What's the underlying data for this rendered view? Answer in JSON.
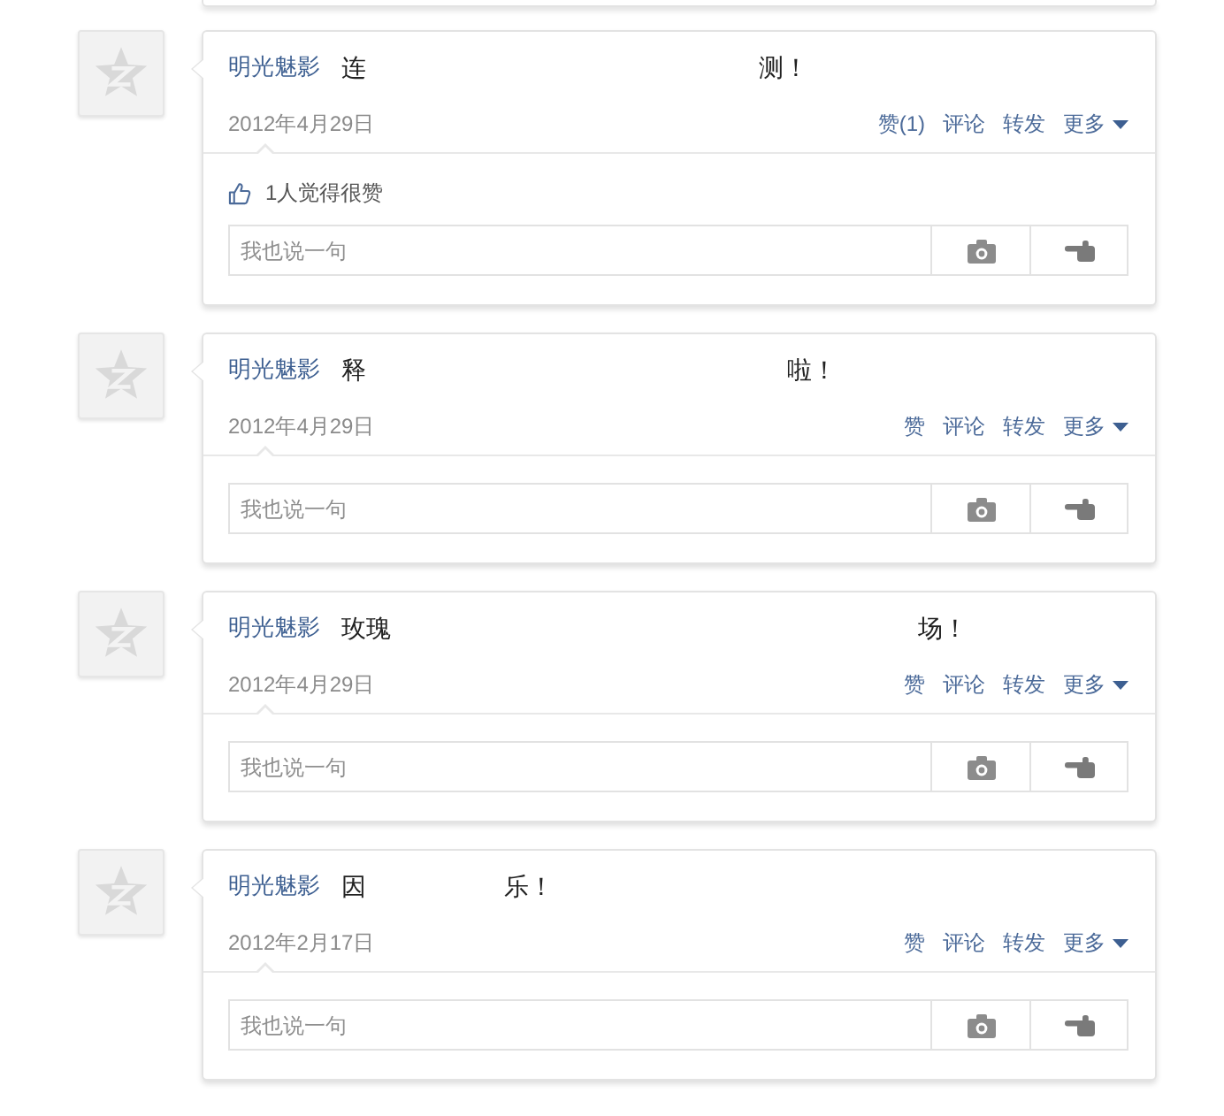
{
  "posts": [
    {
      "author": "明光魅影",
      "text_fragments": [
        "连",
        "测！"
      ],
      "date": "2012年4月29日",
      "actions": [
        {
          "kind": "like",
          "label": "赞(1)"
        },
        {
          "kind": "comment",
          "label": "评论"
        },
        {
          "kind": "repost",
          "label": "转发"
        },
        {
          "kind": "menu",
          "label": "更多"
        }
      ],
      "likes": "1人觉得很赞",
      "comment_box": {
        "placeholder": "我也说一句"
      }
    },
    {
      "author": "明光魅影",
      "text_fragments": [
        "释",
        "啦！"
      ],
      "date": "2012年4月29日",
      "actions": [
        {
          "kind": "like",
          "label": "赞"
        },
        {
          "kind": "comment",
          "label": "评论"
        },
        {
          "kind": "repost",
          "label": "转发"
        },
        {
          "kind": "menu",
          "label": "更多"
        }
      ],
      "comment_box": {
        "placeholder": "我也说一句"
      }
    },
    {
      "author": "明光魅影",
      "text_fragments": [
        "玫瑰",
        "场！"
      ],
      "date": "2012年4月29日",
      "actions": [
        {
          "kind": "like",
          "label": "赞"
        },
        {
          "kind": "comment",
          "label": "评论"
        },
        {
          "kind": "repost",
          "label": "转发"
        },
        {
          "kind": "menu",
          "label": "更多"
        }
      ],
      "comment_box": {
        "placeholder": "我也说一句"
      }
    },
    {
      "author": "明光魅影",
      "text_fragments": [
        "因",
        "乐！"
      ],
      "date": "2012年2月17日",
      "actions": [
        {
          "kind": "like",
          "label": "赞"
        },
        {
          "kind": "comment",
          "label": "评论"
        },
        {
          "kind": "repost",
          "label": "转发"
        },
        {
          "kind": "menu",
          "label": "更多"
        }
      ],
      "comment_box": {
        "placeholder": "我也说一句"
      }
    }
  ]
}
